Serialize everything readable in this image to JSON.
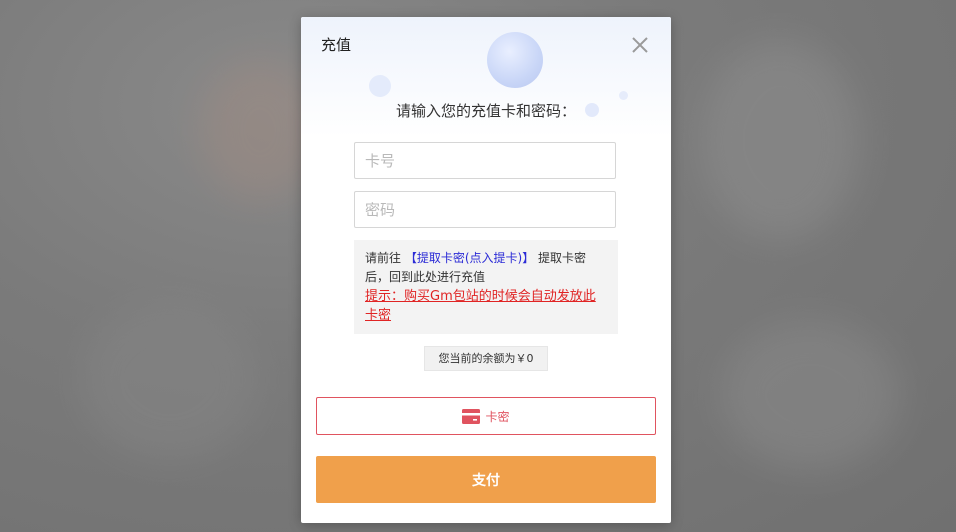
{
  "modal": {
    "title": "充值",
    "close_icon": "close-icon",
    "prompt": "请输入您的充值卡和密码："
  },
  "form": {
    "card_number": {
      "placeholder": "卡号",
      "value": ""
    },
    "password": {
      "placeholder": "密码",
      "value": ""
    }
  },
  "notice": {
    "prefix": "请前往",
    "link_text": "【提取卡密(点入提卡)】",
    "suffix": "提取卡密后，回到此处进行充值",
    "hint": "提示：购买Gm包站的时候会自动发放此卡密"
  },
  "balance": {
    "text": "您当前的余额为￥0"
  },
  "payment_method": {
    "label": "卡密",
    "icon": "card-icon"
  },
  "pay_button": {
    "label": "支付"
  },
  "colors": {
    "accent_orange": "#f0a04b",
    "method_red": "#e0535f",
    "link_blue": "#2b2bd6",
    "hint_red": "#e02424"
  }
}
